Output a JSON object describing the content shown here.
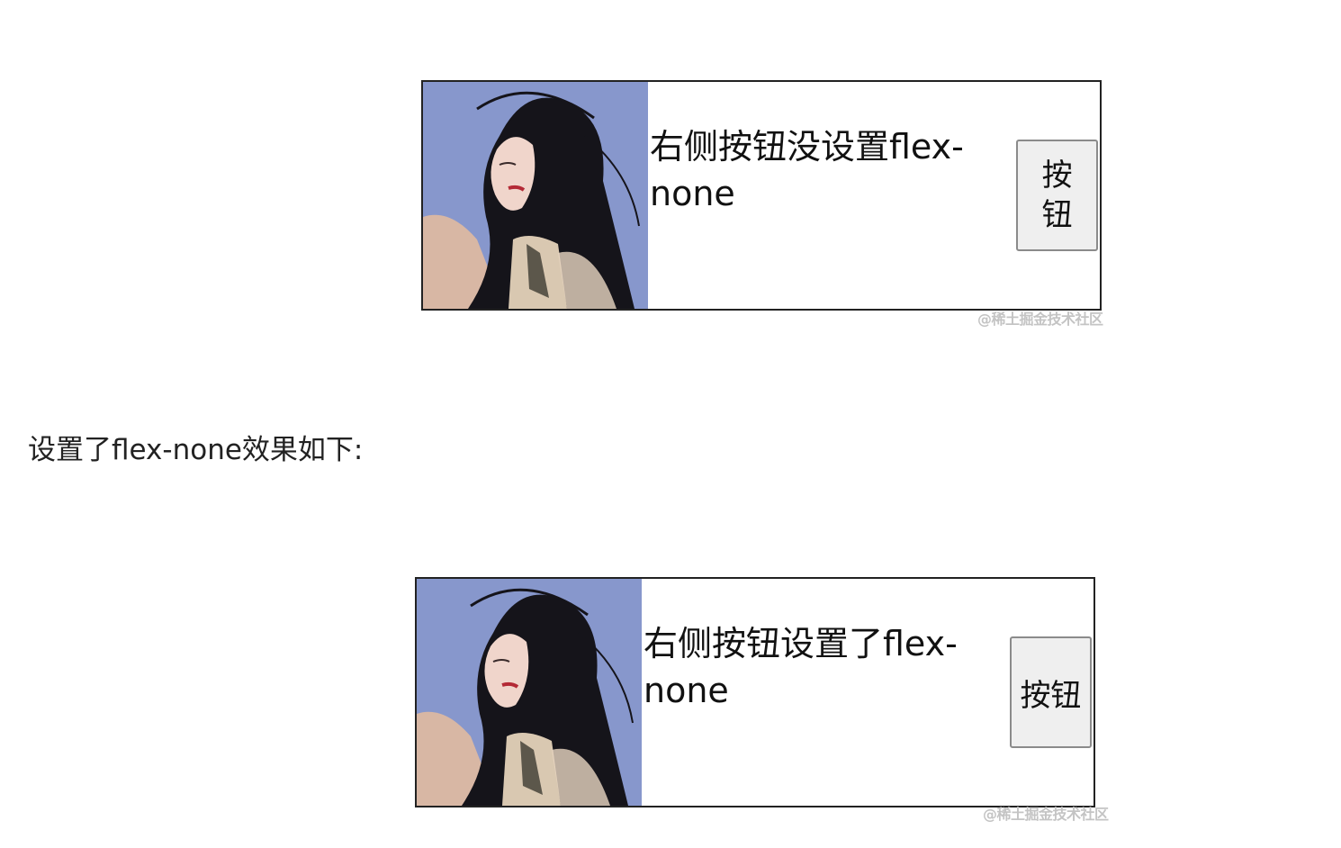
{
  "figures": [
    {
      "description": "右侧按钮没设置flex-none",
      "button_label": "按钮",
      "watermark": "@稀土掘金技术社区"
    },
    {
      "description": "右侧按钮设置了flex-none",
      "button_label": "按钮",
      "watermark": "@稀土掘金技术社区"
    }
  ],
  "caption": "设置了flex-none效果如下:",
  "colors": {
    "photo_sky": "#8a9bd0",
    "hair": "#15141a",
    "button_bg": "#efefef",
    "border": "#222222"
  },
  "icons": {
    "photo": "portrait-photo"
  }
}
